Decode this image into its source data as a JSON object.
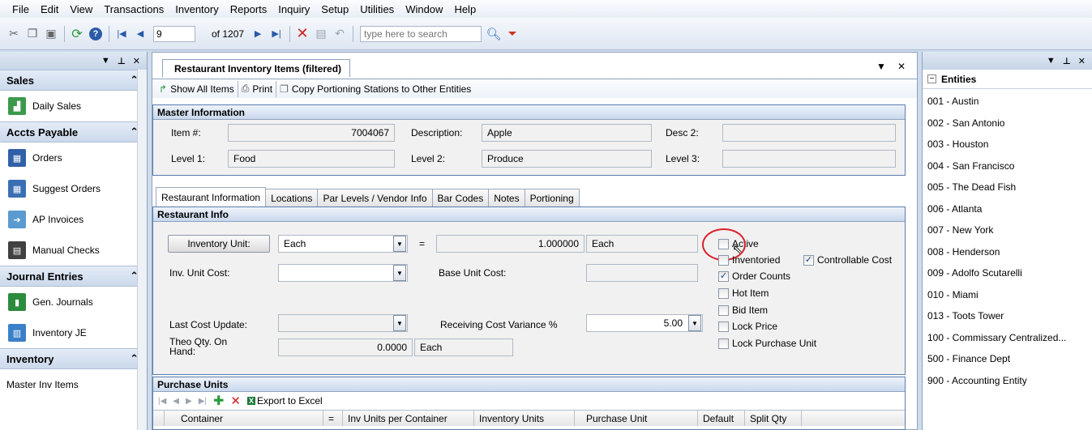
{
  "menu": [
    "File",
    "Edit",
    "View",
    "Transactions",
    "Inventory",
    "Reports",
    "Inquiry",
    "Setup",
    "Utilities",
    "Window",
    "Help"
  ],
  "toolbar": {
    "record_number": "9",
    "record_total": "of 1207",
    "search_placeholder": "type here to search"
  },
  "left_nav": {
    "sections": [
      {
        "title": "Sales",
        "items": [
          {
            "label": "Daily Sales",
            "color": "#3a9a4a"
          }
        ]
      },
      {
        "title": "Accts Payable",
        "items": [
          {
            "label": "Orders",
            "color": "#3060a8"
          },
          {
            "label": "Suggest Orders",
            "color": "#3a6fb4"
          },
          {
            "label": "AP Invoices",
            "color": "#5a9ad0"
          },
          {
            "label": "Manual Checks",
            "color": "#404040"
          }
        ]
      },
      {
        "title": "Journal Entries",
        "items": [
          {
            "label": "Gen. Journals",
            "color": "#2c8c3c"
          },
          {
            "label": "Inventory JE",
            "color": "#3a80c8"
          }
        ]
      },
      {
        "title": "Inventory",
        "items": [
          {
            "label": "Master Inv Items",
            "color": ""
          }
        ]
      }
    ]
  },
  "doc": {
    "tab_title": "Restaurant Inventory Items (filtered)",
    "toolbar": {
      "show_all": "Show All Items",
      "print": "Print",
      "copy": "Copy Portioning Stations to Other Entities"
    },
    "master": {
      "title": "Master Information",
      "item_label": "Item #:",
      "item_value": "7004067",
      "desc_label": "Description:",
      "desc_value": "Apple",
      "desc2_label": "Desc 2:",
      "desc2_value": "",
      "level1_label": "Level 1:",
      "level1_value": "Food",
      "level2_label": "Level 2:",
      "level2_value": "Produce",
      "level3_label": "Level 3:",
      "level3_value": ""
    },
    "tabs": [
      "Restaurant Information",
      "Locations",
      "Par Levels / Vendor Info",
      "Bar Codes",
      "Notes",
      "Portioning"
    ],
    "restaurant": {
      "title": "Restaurant Info",
      "inv_unit_button": "Inventory Unit:",
      "inv_unit_value": "Each",
      "equals": "=",
      "conversion_value": "1.000000",
      "conversion_unit": "Each",
      "inv_unit_cost_label": "Inv. Unit Cost:",
      "inv_unit_cost_value": "",
      "base_unit_cost_label": "Base Unit Cost:",
      "base_unit_cost_value": "",
      "last_cost_label": "Last Cost Update:",
      "last_cost_value": "",
      "variance_label": "Receiving Cost Variance %",
      "variance_value": "5.00",
      "theo_label": "Theo Qty. On Hand:",
      "theo_value": "0.0000",
      "theo_unit": "Each",
      "checks": {
        "active": {
          "label": "Active",
          "checked": false
        },
        "inventoried": {
          "label": "Inventoried",
          "checked": false
        },
        "controllable": {
          "label": "Controllable Cost",
          "checked": true
        },
        "order_counts": {
          "label": "Order Counts",
          "checked": true
        },
        "hot_item": {
          "label": "Hot Item",
          "checked": false
        },
        "bid_item": {
          "label": "Bid Item",
          "checked": false
        },
        "lock_price": {
          "label": "Lock Price",
          "checked": false
        },
        "lock_purchase": {
          "label": "Lock Purchase Unit",
          "checked": false
        }
      }
    },
    "purchase": {
      "title": "Purchase Units",
      "export": "Export to Excel",
      "columns": [
        "Container",
        "=",
        "Inv Units per Container",
        "Inventory Units",
        "Purchase Unit",
        "Default",
        "Split Qty"
      ]
    }
  },
  "entities": {
    "title": "Entities",
    "items": [
      "001 - Austin",
      "002 - San Antonio",
      "003 - Houston",
      "004 - San Francisco",
      "005 - The Dead Fish",
      "006 - Atlanta",
      "007 - New York",
      "008 - Henderson",
      "009 - Adolfo Scutarelli",
      "010 - Miami",
      "013 - Toots Tower",
      "100 - Commissary Centralized...",
      "500 - Finance Dept",
      "900 - Accounting Entity"
    ]
  }
}
